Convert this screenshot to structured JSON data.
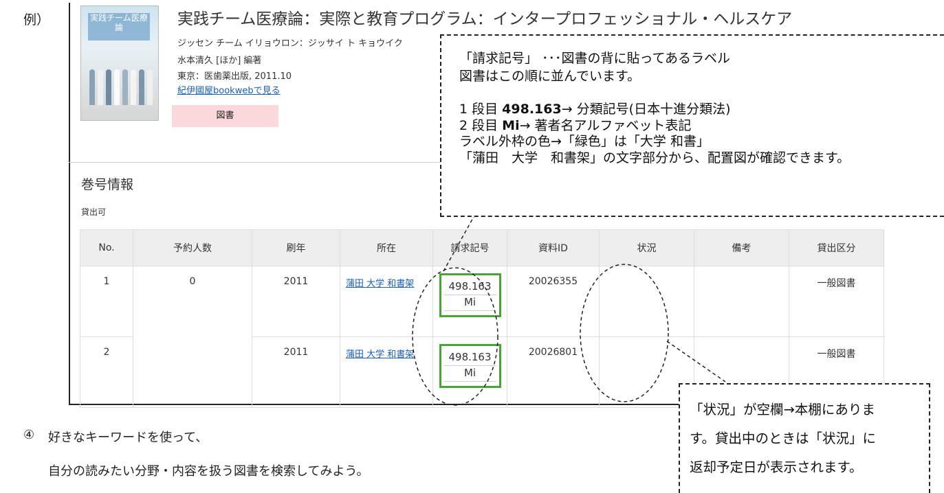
{
  "example_label": "例）",
  "book": {
    "cover_title": "実践チーム医療論",
    "title": "実践チーム医療論：実際と教育プログラム：インタープロフェッショナル・ヘルスケア",
    "reading": "ジッセン チーム イリョウロン：ジッサイ ト キョウイク",
    "author": "水本清久 [ほか] 編著",
    "publisher": "東京：医歯薬出版, 2011.10",
    "link": "紀伊國屋bookwebで見る",
    "type_badge": "図書"
  },
  "holdings": {
    "section_title": "巻号情報",
    "availability": "貸出可",
    "columns": [
      "No.",
      "予約人数",
      "刷年",
      "所在",
      "請求記号",
      "資料ID",
      "状況",
      "備考",
      "貸出区分"
    ],
    "rows": [
      {
        "no": "1",
        "reservations": "0",
        "year": "2011",
        "location": "蒲田 大学 和書架",
        "call_1": "498.163",
        "call_2": "Mi",
        "id": "20026355",
        "status": "",
        "note": "",
        "loan": "一般図書"
      },
      {
        "no": "2",
        "reservations": "",
        "year": "2011",
        "location": "蒲田 大学 和書架",
        "call_1": "498.163",
        "call_2": "Mi",
        "id": "20026801",
        "status": "",
        "note": "",
        "loan": "一般図書"
      }
    ]
  },
  "callout_main": {
    "line1": "「請求記号」 ･･･図書の背に貼ってあるラベル",
    "line2": "図書はこの順に並んでいます。",
    "line3_prefix": "1 段目 ",
    "line3_bold": "498.163",
    "line3_suffix": "→ 分類記号(日本十進分類法)",
    "line4_prefix": "2 段目 ",
    "line4_bold": "Mi",
    "line4_suffix": "→ 著者名アルファベット表記",
    "line5": "ラベル外枠の色→「緑色」は「大学 和書」",
    "line6": "「蒲田　大学　和書架」の文字部分から、配置図が確認できます。"
  },
  "callout_status": {
    "line1": "「状況」が空欄→本棚にありま",
    "line2": "す。貸出中のときは「状況」に",
    "line3": "返却予定日が表示されます。"
  },
  "step4": {
    "number": "④",
    "line1": "好きなキーワードを使って、",
    "line2": "自分の読みたい分野・内容を扱う図書を検索してみよう。"
  }
}
